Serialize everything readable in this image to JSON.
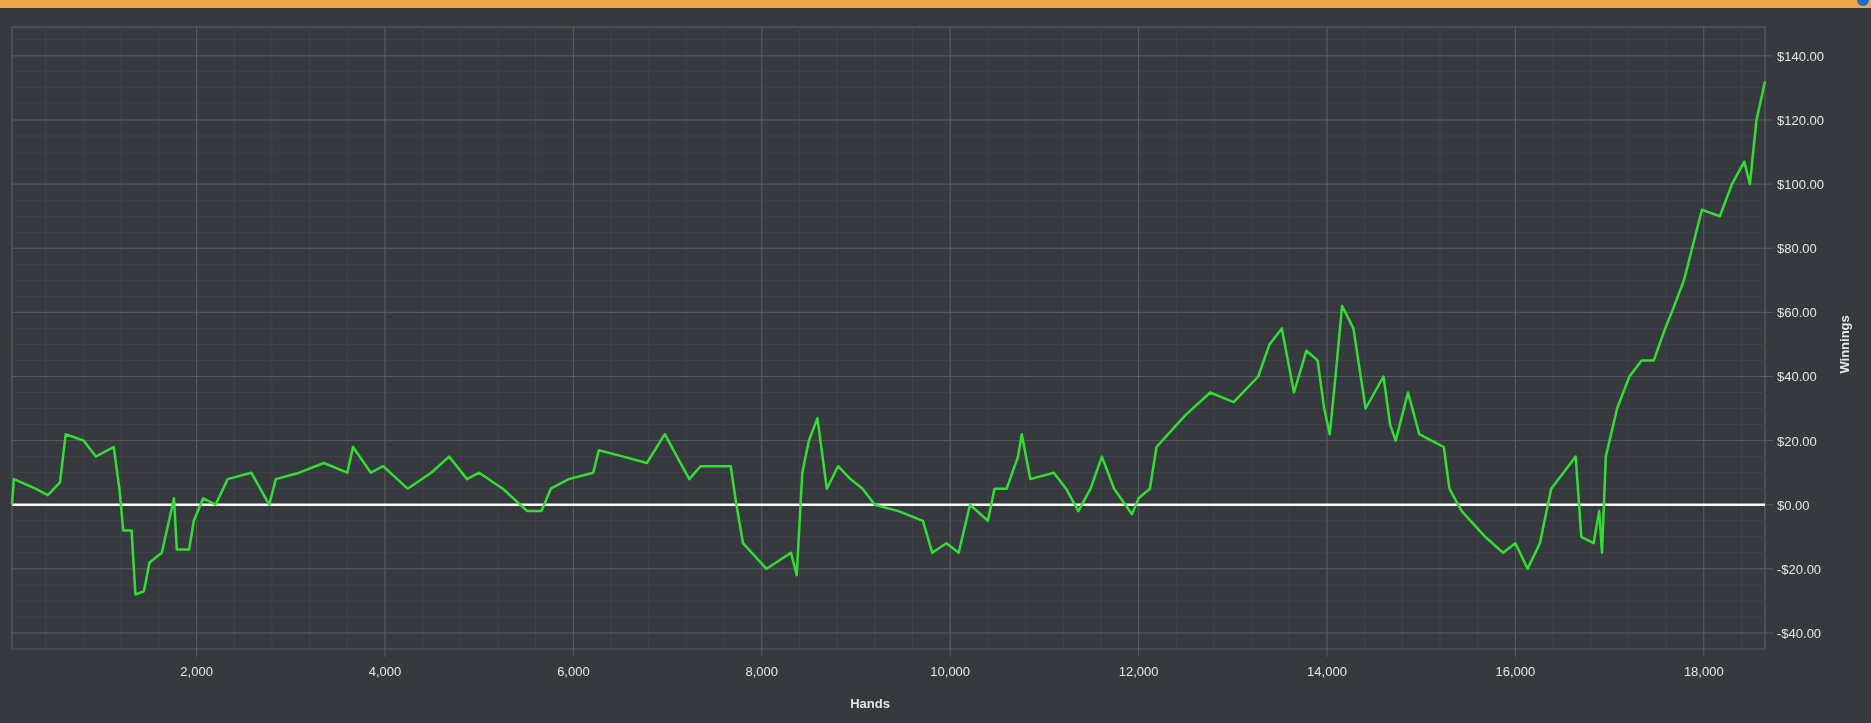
{
  "chart": {
    "chart_data": {
      "type": "line",
      "xlabel": "Hands",
      "ylabel": "Winnings",
      "xlim": [
        40,
        18650
      ],
      "ylim": [
        -45,
        149
      ],
      "xticks": [
        {
          "value": 2000,
          "label": "2,000"
        },
        {
          "value": 4000,
          "label": "4,000"
        },
        {
          "value": 6000,
          "label": "6,000"
        },
        {
          "value": 8000,
          "label": "8,000"
        },
        {
          "value": 10000,
          "label": "10,000"
        },
        {
          "value": 12000,
          "label": "12,000"
        },
        {
          "value": 14000,
          "label": "14,000"
        },
        {
          "value": 16000,
          "label": "16,000"
        },
        {
          "value": 18000,
          "label": "18,000"
        }
      ],
      "yticks": [
        {
          "value": -40,
          "label": "-$40.00"
        },
        {
          "value": -20,
          "label": "-$20.00"
        },
        {
          "value": 0,
          "label": "$0.00"
        },
        {
          "value": 20,
          "label": "$20.00"
        },
        {
          "value": 40,
          "label": "$40.00"
        },
        {
          "value": 60,
          "label": "$60.00"
        },
        {
          "value": 80,
          "label": "$80.00"
        },
        {
          "value": 100,
          "label": "$100.00"
        },
        {
          "value": 120,
          "label": "$120.00"
        },
        {
          "value": 140,
          "label": "$140.00"
        }
      ],
      "x": [
        40,
        60,
        290,
        420,
        550,
        610,
        800,
        930,
        1120,
        1180,
        1220,
        1310,
        1350,
        1440,
        1500,
        1630,
        1760,
        1790,
        1920,
        1970,
        2070,
        2200,
        2330,
        2580,
        2770,
        2840,
        3090,
        3350,
        3600,
        3660,
        3850,
        3980,
        4240,
        4490,
        4680,
        4870,
        5000,
        5250,
        5510,
        5660,
        5760,
        5950,
        6210,
        6270,
        6530,
        6780,
        6970,
        7100,
        7230,
        7350,
        7670,
        7730,
        7800,
        8050,
        8310,
        8370,
        8430,
        8500,
        8590,
        8690,
        8810,
        8940,
        9070,
        9200,
        9450,
        9710,
        9810,
        9960,
        10090,
        10210,
        10400,
        10470,
        10600,
        10720,
        10760,
        10850,
        11100,
        11230,
        11360,
        11490,
        11610,
        11740,
        11930,
        12000,
        12120,
        12190,
        12500,
        12760,
        13010,
        13270,
        13390,
        13520,
        13650,
        13780,
        13900,
        13970,
        14030,
        14090,
        14160,
        14280,
        14410,
        14600,
        14670,
        14730,
        14860,
        14980,
        15110,
        15240,
        15300,
        15430,
        15680,
        15870,
        16000,
        16130,
        16260,
        16380,
        16510,
        16640,
        16700,
        16830,
        16890,
        16920,
        16960,
        17080,
        17210,
        17340,
        17470,
        17590,
        17660,
        17790,
        17980,
        18170,
        18300,
        18430,
        18490,
        18560,
        18650
      ],
      "series": [
        {
          "color": "#33dd33",
          "values": [
            0,
            8,
            5,
            3,
            7,
            22,
            20,
            15,
            18,
            5,
            -8,
            -8,
            -28,
            -27,
            -18,
            -15,
            2,
            -14,
            -14,
            -5,
            2,
            0,
            8,
            10,
            0,
            8,
            10,
            13,
            10,
            18,
            10,
            12,
            5,
            10,
            15,
            8,
            10,
            5,
            -2,
            -2,
            5,
            8,
            10,
            17,
            15,
            13,
            22,
            15,
            8,
            12,
            12,
            0,
            -12,
            -20,
            -15,
            -22,
            10,
            20,
            27,
            5,
            12,
            8,
            5,
            0,
            -2,
            -5,
            -15,
            -12,
            -15,
            0,
            -5,
            5,
            5,
            15,
            22,
            8,
            10,
            5,
            -2,
            5,
            15,
            5,
            -3,
            2,
            5,
            18,
            28,
            35,
            32,
            40,
            50,
            55,
            35,
            48,
            45,
            30,
            22,
            40,
            62,
            55,
            30,
            40,
            25,
            20,
            35,
            22,
            20,
            18,
            5,
            -2,
            -10,
            -15,
            -12,
            -20,
            -12,
            5,
            10,
            15,
            -10,
            -12,
            -2,
            -15,
            15,
            30,
            40,
            45,
            45,
            55,
            60,
            70,
            92,
            90,
            100,
            107,
            100,
            120,
            132
          ]
        }
      ],
      "grid": true
    }
  }
}
